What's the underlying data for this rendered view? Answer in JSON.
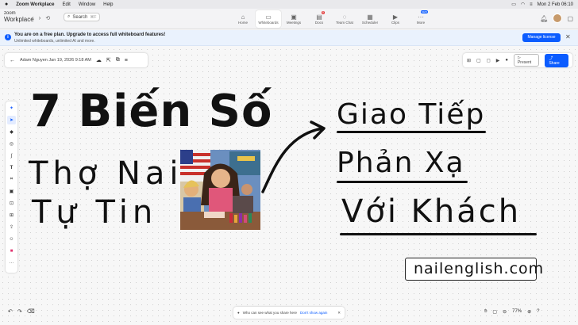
{
  "menubar": {
    "app": "Zoom Workplace",
    "items": [
      "Edit",
      "Window",
      "Help"
    ],
    "clock": "Mon 2 Feb  06:10"
  },
  "header": {
    "logo_top": "zoom",
    "logo_bottom": "Workplace",
    "search_placeholder": "Search",
    "search_shortcut": "⌘F",
    "apps": [
      {
        "label": "Home",
        "icon": "home-icon"
      },
      {
        "label": "Whiteboards",
        "icon": "whiteboard-icon",
        "active": true
      },
      {
        "label": "Meetings",
        "icon": "video-icon"
      },
      {
        "label": "Docs",
        "icon": "docs-icon",
        "badge": "8"
      },
      {
        "label": "Team Chat",
        "icon": "chat-icon"
      },
      {
        "label": "Scheduler",
        "icon": "calendar-icon"
      },
      {
        "label": "Clips",
        "icon": "clips-icon"
      },
      {
        "label": "More",
        "icon": "more-icon",
        "badge": "NEW"
      }
    ]
  },
  "banner": {
    "title": "You are on a free plan. Upgrade to access full whiteboard features!",
    "subtitle": "Unlimited whiteboards, unlimited AI and more.",
    "button": "Manage license",
    "close": "✕"
  },
  "board": {
    "owner_date": "Adam Nguyen Jan 19, 2026 9:18 AM",
    "present": "Present",
    "share": "Share"
  },
  "canvas": {
    "line1": "7 Biến Số",
    "line2": "Thợ Nail",
    "line3": "Tự Tin",
    "right1": "Giao Tiếp",
    "right2": "Phản Xạ",
    "right3": "Với Khách",
    "site": "nailenglish.com"
  },
  "notice": {
    "text": "Who can see what you share here",
    "dont_show": "Don't show again",
    "close": "✕"
  },
  "zoom": {
    "level": "77%"
  },
  "colors": {
    "accent": "#0b5cff",
    "badge": "#e02e2e",
    "banner_bg": "#eaf2fd"
  }
}
